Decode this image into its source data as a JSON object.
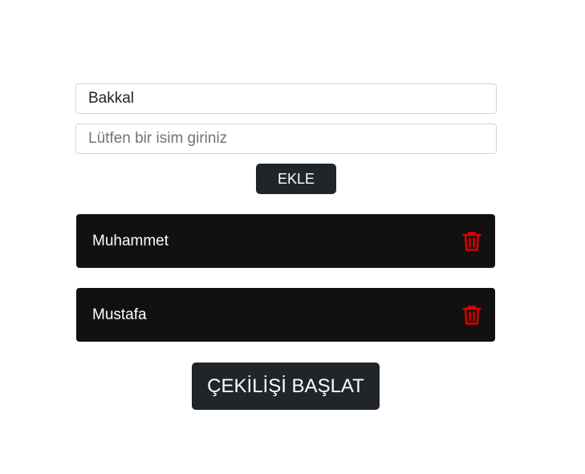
{
  "form": {
    "shop_value": "Bakkal",
    "name_placeholder": "Lütfen bir isim giriniz",
    "add_label": "EKLE"
  },
  "participants": [
    {
      "name": "Muhammet",
      "icon": "trash-icon"
    },
    {
      "name": "Mustafa",
      "icon": "trash-icon"
    }
  ],
  "start_label": "ÇEKİLİŞİ BAŞLAT",
  "colors": {
    "button_bg": "#212529",
    "card_bg": "#111111",
    "trash": "#e00000"
  }
}
